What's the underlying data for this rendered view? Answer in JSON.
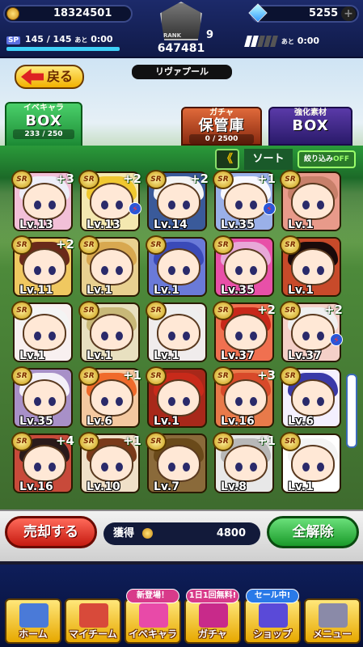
{
  "header": {
    "coins": "18324501",
    "gems": "5255",
    "sp_label": "SP",
    "sp_value": "145 / 145",
    "sp_next_label": "あと",
    "sp_timer": "0:00",
    "rank_label": "RANK",
    "rank_level": "9",
    "rank_points": "647481",
    "team_name": "リヴァプール",
    "bats_label": "あと",
    "bats_timer": "0:00",
    "bats_filled": 2,
    "bats_total": 5
  },
  "back_button": {
    "label": "戻る"
  },
  "tabs": [
    {
      "title": "イベキャラ",
      "main": "BOX",
      "sub": "233 / 250",
      "active": true
    },
    {
      "title": "ガチャ",
      "main": "保管庫",
      "sub": "0 / 2500",
      "active": false
    },
    {
      "title": "強化素材",
      "main": "BOX",
      "sub": "",
      "active": false
    }
  ],
  "sort": {
    "chevron": "《",
    "label": "ソート",
    "filter_label": "絞り込み",
    "filter_state": "OFF"
  },
  "cards": [
    {
      "rarity": "SR",
      "bonus": "+3",
      "level": "Lv.13",
      "hair": "#eeeef8",
      "bg": "#f2c0d8",
      "bolt": false
    },
    {
      "rarity": "SR",
      "bonus": "+2",
      "level": "Lv.13",
      "hair": "#f0c830",
      "bg": "#f4e8b0",
      "bolt": true
    },
    {
      "rarity": "SR",
      "bonus": "+2",
      "level": "Lv.14",
      "hair": "#f4f4f4",
      "bg": "#3a5a9a",
      "bolt": false
    },
    {
      "rarity": "SR",
      "bonus": "+1",
      "level": "Lv.35",
      "hair": "#f8f8ff",
      "bg": "#9ab0e8",
      "bolt": true
    },
    {
      "rarity": "SR",
      "bonus": "",
      "level": "Lv.1",
      "hair": "#c8806a",
      "bg": "#e89a8a",
      "bolt": false
    },
    {
      "rarity": "SR",
      "bonus": "+2",
      "level": "Lv.11",
      "hair": "#6a2a1a",
      "bg": "#f0c860",
      "bolt": false
    },
    {
      "rarity": "SR",
      "bonus": "",
      "level": "Lv.1",
      "hair": "#d8a850",
      "bg": "#e8d090",
      "bolt": false
    },
    {
      "rarity": "SR",
      "bonus": "",
      "level": "Lv.1",
      "hair": "#3a4ab8",
      "bg": "#6a7ad8",
      "bolt": false
    },
    {
      "rarity": "SR",
      "bonus": "",
      "level": "Lv.35",
      "hair": "#e8a8d8",
      "bg": "#e850a8",
      "bolt": false
    },
    {
      "rarity": "SR",
      "bonus": "",
      "level": "Lv.1",
      "hair": "#1a0a0a",
      "bg": "#c84a2a",
      "bolt": false
    },
    {
      "rarity": "SR",
      "bonus": "",
      "level": "Lv.1",
      "hair": "#f4f4f4",
      "bg": "#f8f0f0",
      "bolt": false
    },
    {
      "rarity": "SR",
      "bonus": "",
      "level": "Lv.1",
      "hair": "#c8b878",
      "bg": "#e8e0c0",
      "bolt": false
    },
    {
      "rarity": "SR",
      "bonus": "",
      "level": "Lv.1",
      "hair": "#eeeeee",
      "bg": "#f0ecec",
      "bolt": false
    },
    {
      "rarity": "SR",
      "bonus": "+2",
      "level": "Lv.37",
      "hair": "#c8281a",
      "bg": "#f07050",
      "bolt": false
    },
    {
      "rarity": "SR",
      "bonus": "+2",
      "level": "Lv.37",
      "hair": "#f0f0f0",
      "bg": "#f4d0c8",
      "bolt": true
    },
    {
      "rarity": "SR",
      "bonus": "",
      "level": "Lv.35",
      "hair": "#f4f0f8",
      "bg": "#a890c8",
      "bolt": false
    },
    {
      "rarity": "SR",
      "bonus": "+1",
      "level": "Lv.6",
      "hair": "#f06a2a",
      "bg": "#f4c8a0",
      "bolt": false
    },
    {
      "rarity": "SR",
      "bonus": "",
      "level": "Lv.1",
      "hair": "#c82a1a",
      "bg": "#a8281a",
      "bolt": false
    },
    {
      "rarity": "SR",
      "bonus": "+3",
      "level": "Lv.16",
      "hair": "#d84a2a",
      "bg": "#e87a4a",
      "bolt": false
    },
    {
      "rarity": "SR",
      "bonus": "",
      "level": "Lv.6",
      "hair": "#3a3aa8",
      "bg": "#f4f0ff",
      "bolt": false
    },
    {
      "rarity": "SR",
      "bonus": "+4",
      "level": "Lv.16",
      "hair": "#2a1a1a",
      "bg": "#c84a3a",
      "bolt": false
    },
    {
      "rarity": "SR",
      "bonus": "+1",
      "level": "Lv.10",
      "hair": "#7a3a1a",
      "bg": "#f0e0c8",
      "bolt": false
    },
    {
      "rarity": "SR",
      "bonus": "",
      "level": "Lv.7",
      "hair": "#6a4a1a",
      "bg": "#8a6a3a",
      "bolt": false
    },
    {
      "rarity": "SR",
      "bonus": "+1",
      "level": "Lv.8",
      "hair": "#b8b8b8",
      "bg": "#e8e8e8",
      "bolt": false
    },
    {
      "rarity": "SR",
      "bonus": "",
      "level": "Lv.1",
      "hair": "#f4f4f4",
      "bg": "#ffffff",
      "bolt": false
    }
  ],
  "footer": {
    "sell_label": "売却する",
    "earn_label": "獲得",
    "earn_value": "4800",
    "clear_label": "全解除"
  },
  "nav": [
    {
      "label": "ホーム",
      "badge": "",
      "color": "#4a7ad8"
    },
    {
      "label": "マイチーム",
      "badge": "",
      "color": "#d84a3a"
    },
    {
      "label": "イベキャラ",
      "badge": "新登場！",
      "color": "#e84aa8"
    },
    {
      "label": "ガチャ",
      "badge": "1日1回無料!",
      "color": "#c82a8a"
    },
    {
      "label": "ショップ",
      "badge": "セール中!",
      "color": "#5a4ad8"
    },
    {
      "label": "メニュー",
      "badge": "",
      "color": "#8a8aa8"
    }
  ]
}
